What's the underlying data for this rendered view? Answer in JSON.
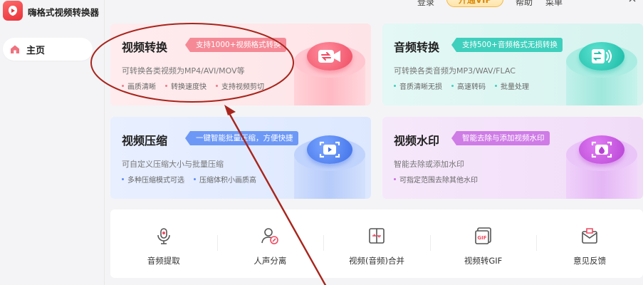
{
  "app": {
    "name": "嗨格式视频转换器"
  },
  "top_bar": {
    "login": "登录",
    "vip": "开通VIP",
    "help": "帮助",
    "menu": "菜单"
  },
  "sidebar": {
    "home_label": "主页"
  },
  "cards": [
    {
      "title": "视频转换",
      "tag": "支持1000+视频格式转换",
      "desc": "可转换各类视频为MP4/AVI/MOV等",
      "features": [
        "画质清晰",
        "转换速度快",
        "支持视频剪切"
      ],
      "icon": "video-convert-icon"
    },
    {
      "title": "音频转换",
      "tag": "支持500+音频格式无损转换",
      "desc": "可转换各类音频为MP3/WAV/FLAC",
      "features": [
        "音质清晰无损",
        "高速转码",
        "批量处理"
      ],
      "icon": "audio-convert-icon"
    },
    {
      "title": "视频压缩",
      "tag": "一键智能批量压缩，方便快捷",
      "desc": "可自定义压缩大小与批量压缩",
      "features": [
        "多种压缩模式可选",
        "压缩体积小画质高"
      ],
      "icon": "video-compress-icon"
    },
    {
      "title": "视频水印",
      "tag": "智能去除与添加视频水印",
      "desc": "智能去除或添加水印",
      "features": [
        "可指定范围去除其他水印"
      ],
      "icon": "watermark-icon"
    }
  ],
  "tools": [
    {
      "label": "音频提取",
      "icon": "audio-extract-icon"
    },
    {
      "label": "人声分离",
      "icon": "vocal-separation-icon"
    },
    {
      "label": "视频(音频)合并",
      "icon": "merge-icon"
    },
    {
      "label": "视频转GIF",
      "icon": "gif-icon"
    },
    {
      "label": "意见反馈",
      "icon": "feedback-icon"
    }
  ],
  "colors": {
    "brand_red": "#e8313a",
    "annotation": "#a8251c",
    "red_tag": "#f58a96",
    "teal_tag": "#3fcfbd",
    "blue_tag": "#6d98f6",
    "purple_tag": "#cf7ce6"
  }
}
